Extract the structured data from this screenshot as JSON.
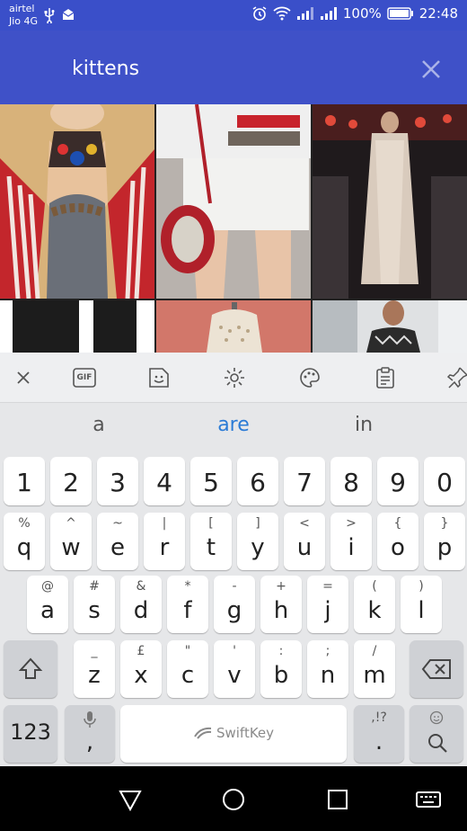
{
  "status": {
    "carrier1": "airtel",
    "carrier2": "Jio 4G",
    "battery": "100%",
    "time": "22:48"
  },
  "search": {
    "query": "kittens"
  },
  "suggestions": [
    "a",
    "are",
    "in"
  ],
  "keyboard": {
    "numbers": [
      "1",
      "2",
      "3",
      "4",
      "5",
      "6",
      "7",
      "8",
      "9",
      "0"
    ],
    "row1": [
      {
        "main": "q",
        "sub": "%"
      },
      {
        "main": "w",
        "sub": "^"
      },
      {
        "main": "e",
        "sub": "~"
      },
      {
        "main": "r",
        "sub": "|"
      },
      {
        "main": "t",
        "sub": "["
      },
      {
        "main": "y",
        "sub": "]"
      },
      {
        "main": "u",
        "sub": "<"
      },
      {
        "main": "i",
        "sub": ">"
      },
      {
        "main": "o",
        "sub": "{"
      },
      {
        "main": "p",
        "sub": "}"
      }
    ],
    "row2": [
      {
        "main": "a",
        "sub": "@"
      },
      {
        "main": "s",
        "sub": "#"
      },
      {
        "main": "d",
        "sub": "&"
      },
      {
        "main": "f",
        "sub": "*"
      },
      {
        "main": "g",
        "sub": "-"
      },
      {
        "main": "h",
        "sub": "+"
      },
      {
        "main": "j",
        "sub": "="
      },
      {
        "main": "k",
        "sub": "("
      },
      {
        "main": "l",
        "sub": ")"
      }
    ],
    "row3": [
      {
        "main": "z",
        "sub": "_"
      },
      {
        "main": "x",
        "sub": "£"
      },
      {
        "main": "c",
        "sub": "\""
      },
      {
        "main": "v",
        "sub": "'"
      },
      {
        "main": "b",
        "sub": ":"
      },
      {
        "main": "n",
        "sub": ";"
      },
      {
        "main": "m",
        "sub": "/"
      }
    ],
    "num_label": "123",
    "comma": ",",
    "period": ".",
    "period_sub": ",!?",
    "space_brand": "SwiftKey"
  },
  "toolbar": {
    "gif_label": "GIF"
  },
  "colors": {
    "appbar": "#3f51c8",
    "statusbar": "#3a4fc9",
    "suggestion_active": "#2b7bd6"
  }
}
